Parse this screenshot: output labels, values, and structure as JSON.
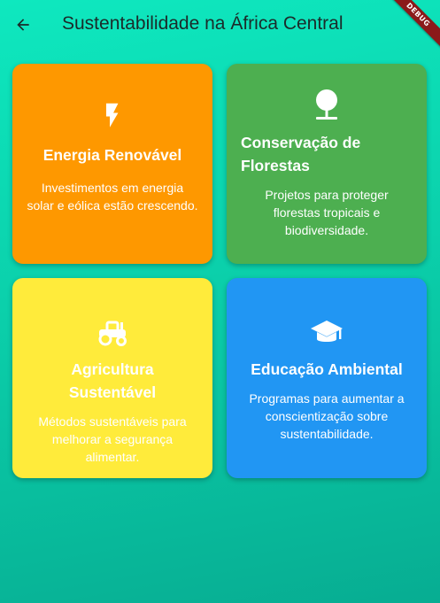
{
  "app_bar": {
    "title": "Sustentabilidade na África Central",
    "back_icon": "arrow-back-icon",
    "debug_label": "DEBUG"
  },
  "colors": {
    "energy": "#fe9800",
    "forest": "#4daf50",
    "agriculture": "#ffeb3b",
    "education": "#2196f3",
    "background_top": "#0ee8bf",
    "background_bottom": "#07ad92"
  },
  "cards": [
    {
      "title": "Energia Renovável",
      "description": "Investimentos em energia solar e eólica estão crescendo.",
      "icon": "bolt-icon"
    },
    {
      "title": "Conservação de Florestas",
      "description": "Projetos para proteger florestas tropicais e biodiversidade.",
      "icon": "tree-icon"
    },
    {
      "title": "Agricultura Sustentável",
      "description": "Métodos sustentáveis para melhorar a segurança alimentar.",
      "icon": "tractor-icon"
    },
    {
      "title": "Educação Ambiental",
      "description": "Programas para aumentar a conscientização sobre sustentabilidade.",
      "icon": "school-icon"
    }
  ]
}
